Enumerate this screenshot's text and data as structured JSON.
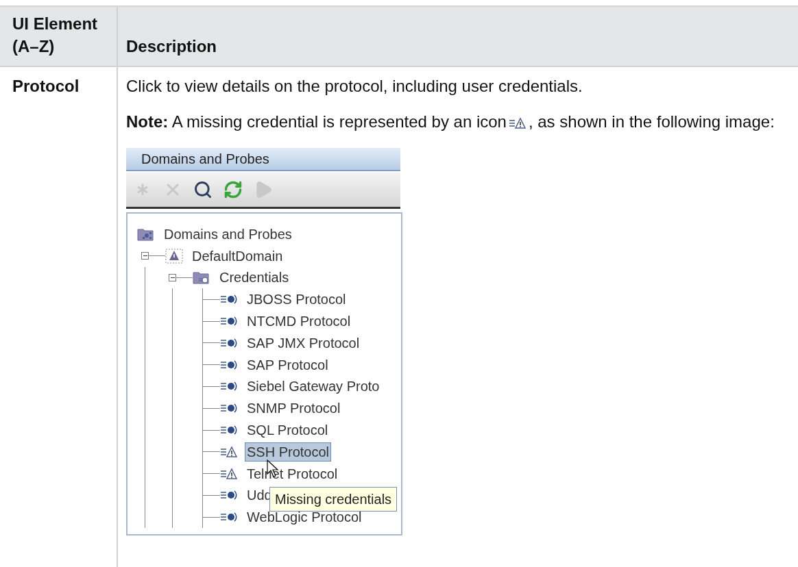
{
  "table": {
    "columns": [
      "UI Element (A–Z)",
      "Description"
    ],
    "rows": [
      {
        "ui_element": "Protocol",
        "description": "Click to view details on the protocol, including user credentials.",
        "note": [
          "**Note:** A missing credential is represented by an icon",
          ", as shown in the following image:"
        ],
        "figure": {
          "panel_title": "Domains and Probes",
          "toolbar": [
            {
              "kind": "asterisk",
              "disabled": true
            },
            {
              "kind": "delete",
              "disabled": true
            },
            {
              "kind": "search",
              "disabled": false
            },
            {
              "kind": "refresh",
              "disabled": false
            },
            {
              "kind": "play",
              "disabled": true
            }
          ],
          "tree": {
            "label": "Domains and Probes",
            "kind": "probes-folder",
            "selected": false,
            "children": [
              {
                "label": "DefaultDomain",
                "kind": "domain",
                "expanded": true,
                "selected": false,
                "children": [
                  {
                    "label": "Credentials",
                    "kind": "credentials-folder",
                    "expanded": true,
                    "selected": false,
                    "children": [
                      {
                        "label": "JBOSS Protocol",
                        "kind": "protocol",
                        "selected": false
                      },
                      {
                        "label": "NTCMD Protocol",
                        "kind": "protocol",
                        "selected": false
                      },
                      {
                        "label": "SAP JMX Protocol",
                        "kind": "protocol",
                        "selected": false
                      },
                      {
                        "label": "SAP Protocol",
                        "kind": "protocol",
                        "selected": false
                      },
                      {
                        "label": "Siebel Gateway Proto",
                        "kind": "protocol",
                        "selected": false
                      },
                      {
                        "label": "SNMP Protocol",
                        "kind": "protocol",
                        "selected": false
                      },
                      {
                        "label": "SQL Protocol",
                        "kind": "protocol",
                        "selected": false
                      },
                      {
                        "label": "SSH Protocol",
                        "kind": "missing-credential",
                        "selected": true
                      },
                      {
                        "label": "Telnet Protocol",
                        "kind": "missing-credential",
                        "selected": false
                      },
                      {
                        "label": "Udd",
                        "kind": "protocol",
                        "selected": false
                      },
                      {
                        "label": "WebLogic Protocol",
                        "kind": "protocol",
                        "selected": false
                      }
                    ]
                  }
                ]
              }
            ]
          },
          "tooltip": "Missing credentials"
        }
      }
    ]
  }
}
